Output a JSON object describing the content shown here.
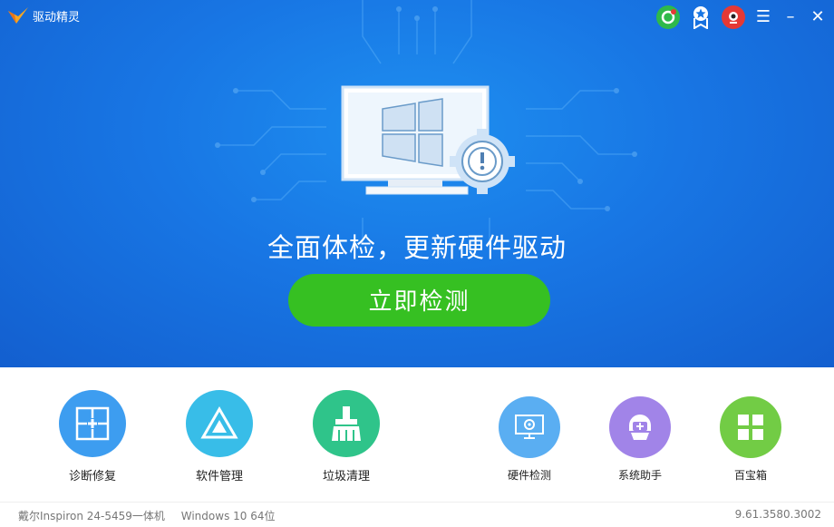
{
  "app": {
    "title": "驱动精灵"
  },
  "window_buttons": {
    "menu": "☰",
    "minimize": "–",
    "close": "✕"
  },
  "main": {
    "slogan": "全面体检，更新硬件驱动",
    "scan_button": "立即检测"
  },
  "tools_large": [
    {
      "label": "诊断修复",
      "icon": "diagnose-repair-icon",
      "color": "#3d9df0"
    },
    {
      "label": "软件管理",
      "icon": "software-manage-icon",
      "color": "#38bde8"
    },
    {
      "label": "垃圾清理",
      "icon": "broom-icon",
      "color": "#2fc48a"
    }
  ],
  "tools_small": [
    {
      "label": "硬件检测",
      "icon": "hardware-detect-icon",
      "color": "#5aaef2"
    },
    {
      "label": "系统助手",
      "icon": "system-assistant-icon",
      "color": "#a184e8"
    },
    {
      "label": "百宝箱",
      "icon": "toolbox-icon",
      "color": "#72cc45"
    }
  ],
  "status": {
    "device": "戴尔Inspiron 24-5459一体机",
    "os": "Windows 10 64位",
    "version": "9.61.3580.3002"
  }
}
